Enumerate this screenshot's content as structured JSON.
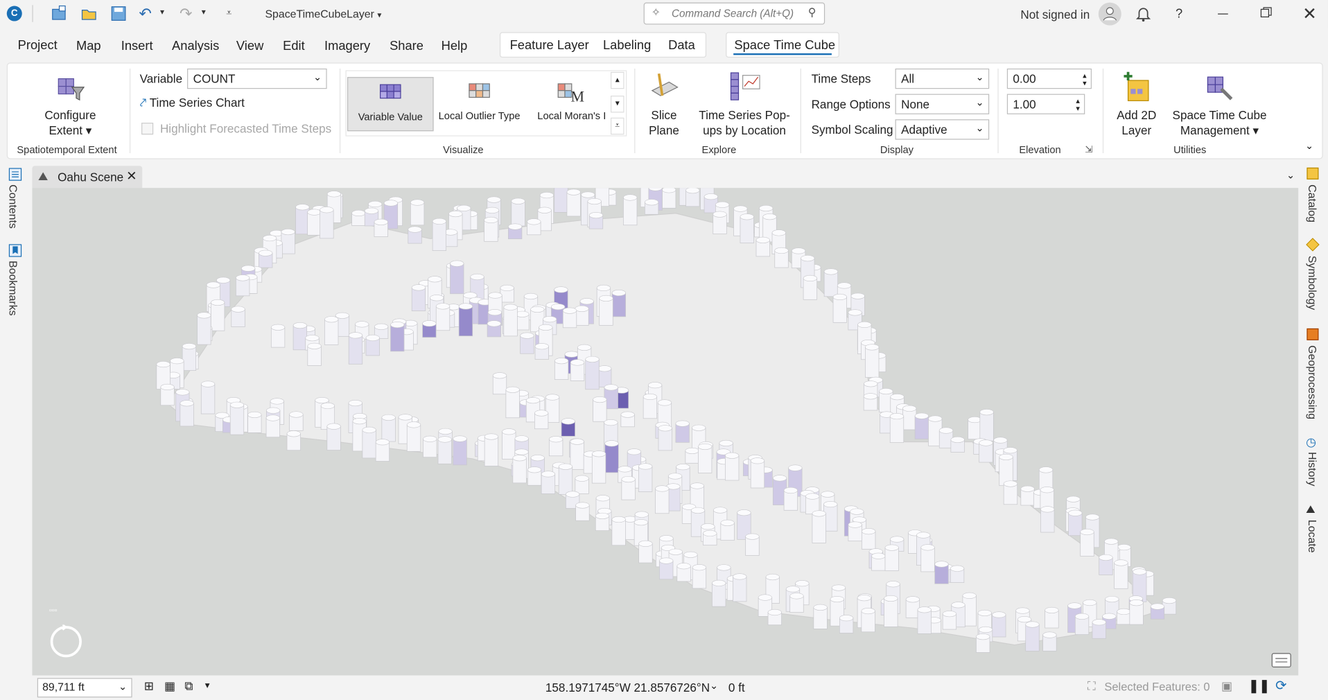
{
  "titlebar": {
    "project_name": "SpaceTimeCubeLayer",
    "command_search_placeholder": "Command Search (Alt+Q)",
    "signin_status": "Not signed in",
    "help_label": "?"
  },
  "menu": {
    "items": [
      "Project",
      "Map",
      "Insert",
      "Analysis",
      "View",
      "Edit",
      "Imagery",
      "Share",
      "Help"
    ],
    "context_tabs": [
      "Feature Layer",
      "Labeling",
      "Data"
    ],
    "active_tab": "Space Time Cube"
  },
  "ribbon": {
    "spatiotemporal": {
      "button": "Configure",
      "button_line2": "Extent",
      "group": "Spatiotemporal Extent"
    },
    "visualize": {
      "variable_label": "Variable",
      "variable_value": "COUNT",
      "time_series_chart": "Time Series Chart",
      "highlight_forecasted": "Highlight Forecasted Time Steps",
      "gallery": [
        "Variable Value",
        "Local Outlier Type",
        "Local Moran's I"
      ],
      "group": "Visualize"
    },
    "explore": {
      "slice_line1": "Slice",
      "slice_line2": "Plane",
      "ts_line1": "Time Series Pop-",
      "ts_line2": "ups by Location",
      "group": "Explore"
    },
    "display": {
      "time_steps_label": "Time Steps",
      "time_steps_value": "All",
      "range_options_label": "Range Options",
      "range_options_value": "None",
      "symbol_scaling_label": "Symbol Scaling",
      "symbol_scaling_value": "Adaptive",
      "group": "Display"
    },
    "elevation": {
      "value1": "0.00",
      "value2": "1.00",
      "group": "Elevation"
    },
    "utilities": {
      "add_line1": "Add 2D",
      "add_line2": "Layer",
      "stc_line1": "Space Time Cube",
      "stc_line2": "Management",
      "group": "Utilities"
    }
  },
  "view_tab": {
    "label": "Oahu Scene"
  },
  "left_panes": [
    "Contents",
    "Bookmarks"
  ],
  "right_panes": [
    "Catalog",
    "Symbology",
    "Geoprocessing",
    "History",
    "Locate"
  ],
  "status": {
    "scale": "89,711 ft",
    "coordinates": "158.1971745°W 21.8576726°N",
    "elevation": "0 ft",
    "selected_features": "Selected Features: 0"
  },
  "colors": {
    "accent": "#1a6fb5",
    "ribbon_bg": "#ffffff",
    "map_bg": "#d6d8d6",
    "land": "#ececec",
    "hex_low": "#f2f2f6",
    "hex_high": "#3a2d7a"
  }
}
